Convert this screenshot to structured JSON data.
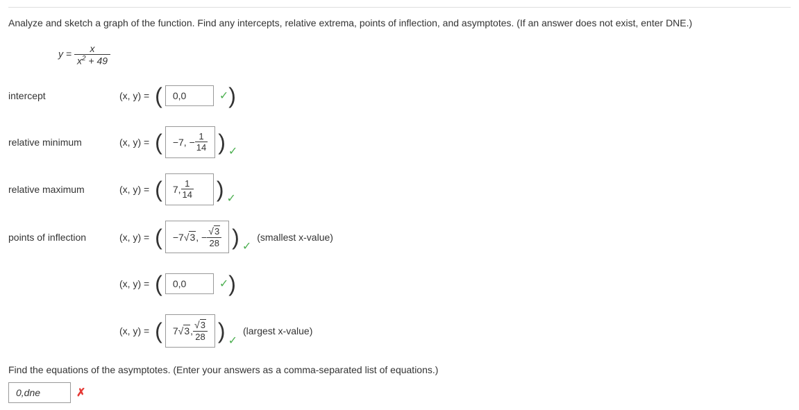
{
  "instruction": "Analyze and sketch a graph of the function. Find any intercepts, relative extrema, points of inflection, and asymptotes. (If an answer does not exist, enter DNE.)",
  "equation": {
    "lhs": "y =",
    "numerator": "x",
    "denominator_base": "x",
    "denominator_exp": "2",
    "denominator_rest": " + 49"
  },
  "rows": {
    "intercept": {
      "label": "intercept",
      "xy": "(x, y)  =",
      "value": "0,0"
    },
    "relmin": {
      "label": "relative minimum",
      "xy": "(x, y)  =",
      "prefix": "−7, −",
      "frac_num": "1",
      "frac_den": "14"
    },
    "relmax": {
      "label": "relative maximum",
      "xy": "(x, y)  =",
      "prefix": "7,",
      "frac_num": "1",
      "frac_den": "14"
    },
    "poi1": {
      "label": "points of inflection",
      "xy": "(x, y)  =",
      "value_a": "−7",
      "value_radicand": "3",
      "mid": " , −",
      "frac_num_rad": "3",
      "frac_den": "28",
      "after": "(smallest x-value)"
    },
    "poi2": {
      "xy": "(x, y)  =",
      "value": "0,0"
    },
    "poi3": {
      "xy": "(x, y)  =",
      "value_a": "7",
      "value_radicand": "3",
      "mid": " ,",
      "frac_num_rad": "3",
      "frac_den": "28",
      "after": "(largest x-value)"
    }
  },
  "asymptote": {
    "instruction": "Find the equations of the asymptotes. (Enter your answers as a comma-separated list of equations.)",
    "value": "0,dne"
  }
}
